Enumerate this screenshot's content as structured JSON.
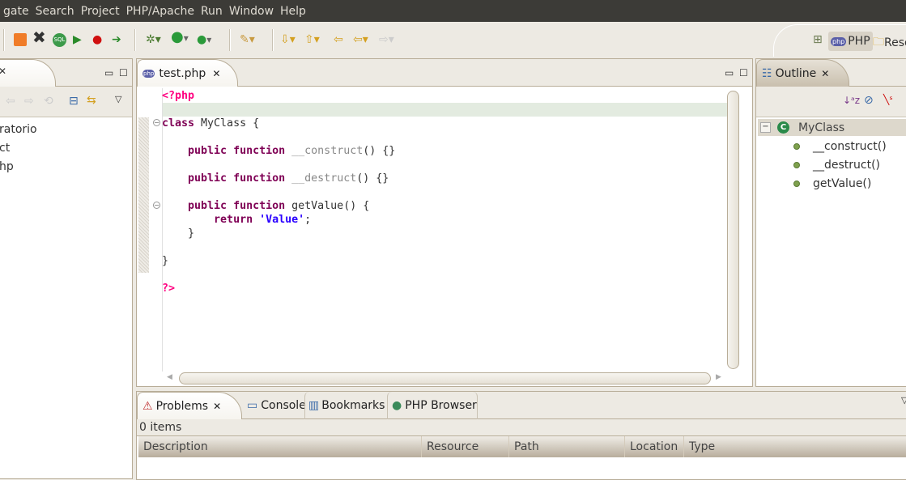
{
  "menu": [
    "gate",
    "Search",
    "Project",
    "PHP/Apache",
    "Run",
    "Window",
    "Help"
  ],
  "perspectives": {
    "php": "PHP",
    "resource": "Reso"
  },
  "left_panel": {
    "items": [
      "ratorio",
      "ct",
      "hp"
    ]
  },
  "editor": {
    "tab": "test.php",
    "lines": [
      [
        [
          "tag",
          "<?php"
        ]
      ],
      [],
      [
        [
          "kw",
          "class"
        ],
        [
          "p",
          " MyClass {"
        ]
      ],
      [],
      [
        [
          "p",
          "    "
        ],
        [
          "kw",
          "public"
        ],
        [
          "p",
          " "
        ],
        [
          "kw",
          "function"
        ],
        [
          "p",
          " "
        ],
        [
          "magic",
          "__construct"
        ],
        [
          "p",
          "() {}"
        ]
      ],
      [],
      [
        [
          "p",
          "    "
        ],
        [
          "kw",
          "public"
        ],
        [
          "p",
          " "
        ],
        [
          "kw",
          "function"
        ],
        [
          "p",
          " "
        ],
        [
          "magic",
          "__destruct"
        ],
        [
          "p",
          "() {}"
        ]
      ],
      [],
      [
        [
          "p",
          "    "
        ],
        [
          "kw",
          "public"
        ],
        [
          "p",
          " "
        ],
        [
          "kw",
          "function"
        ],
        [
          "p",
          " getValue() {"
        ]
      ],
      [
        [
          "p",
          "        "
        ],
        [
          "kw",
          "return"
        ],
        [
          "p",
          " "
        ],
        [
          "str",
          "'Value'"
        ],
        [
          "p",
          ";"
        ]
      ],
      [
        [
          "p",
          "    }"
        ]
      ],
      [],
      [
        [
          "p",
          "}"
        ]
      ],
      [],
      [
        [
          "tag",
          "?>"
        ]
      ]
    ]
  },
  "outline": {
    "title": "Outline",
    "class": "MyClass",
    "members": [
      "__construct()",
      "__destruct()",
      "getValue()"
    ]
  },
  "bottom": {
    "tabs": [
      "Problems",
      "Console",
      "Bookmarks",
      "PHP Browser"
    ],
    "status": "0 items",
    "columns": [
      "Description",
      "Resource",
      "Path",
      "Location",
      "Type"
    ]
  },
  "colors": {
    "menubar": "#3c3b37",
    "keyword": "#7f0055",
    "php_tag": "#ff0080",
    "string": "#2a00ff",
    "current_line": "#e3ebe0"
  }
}
